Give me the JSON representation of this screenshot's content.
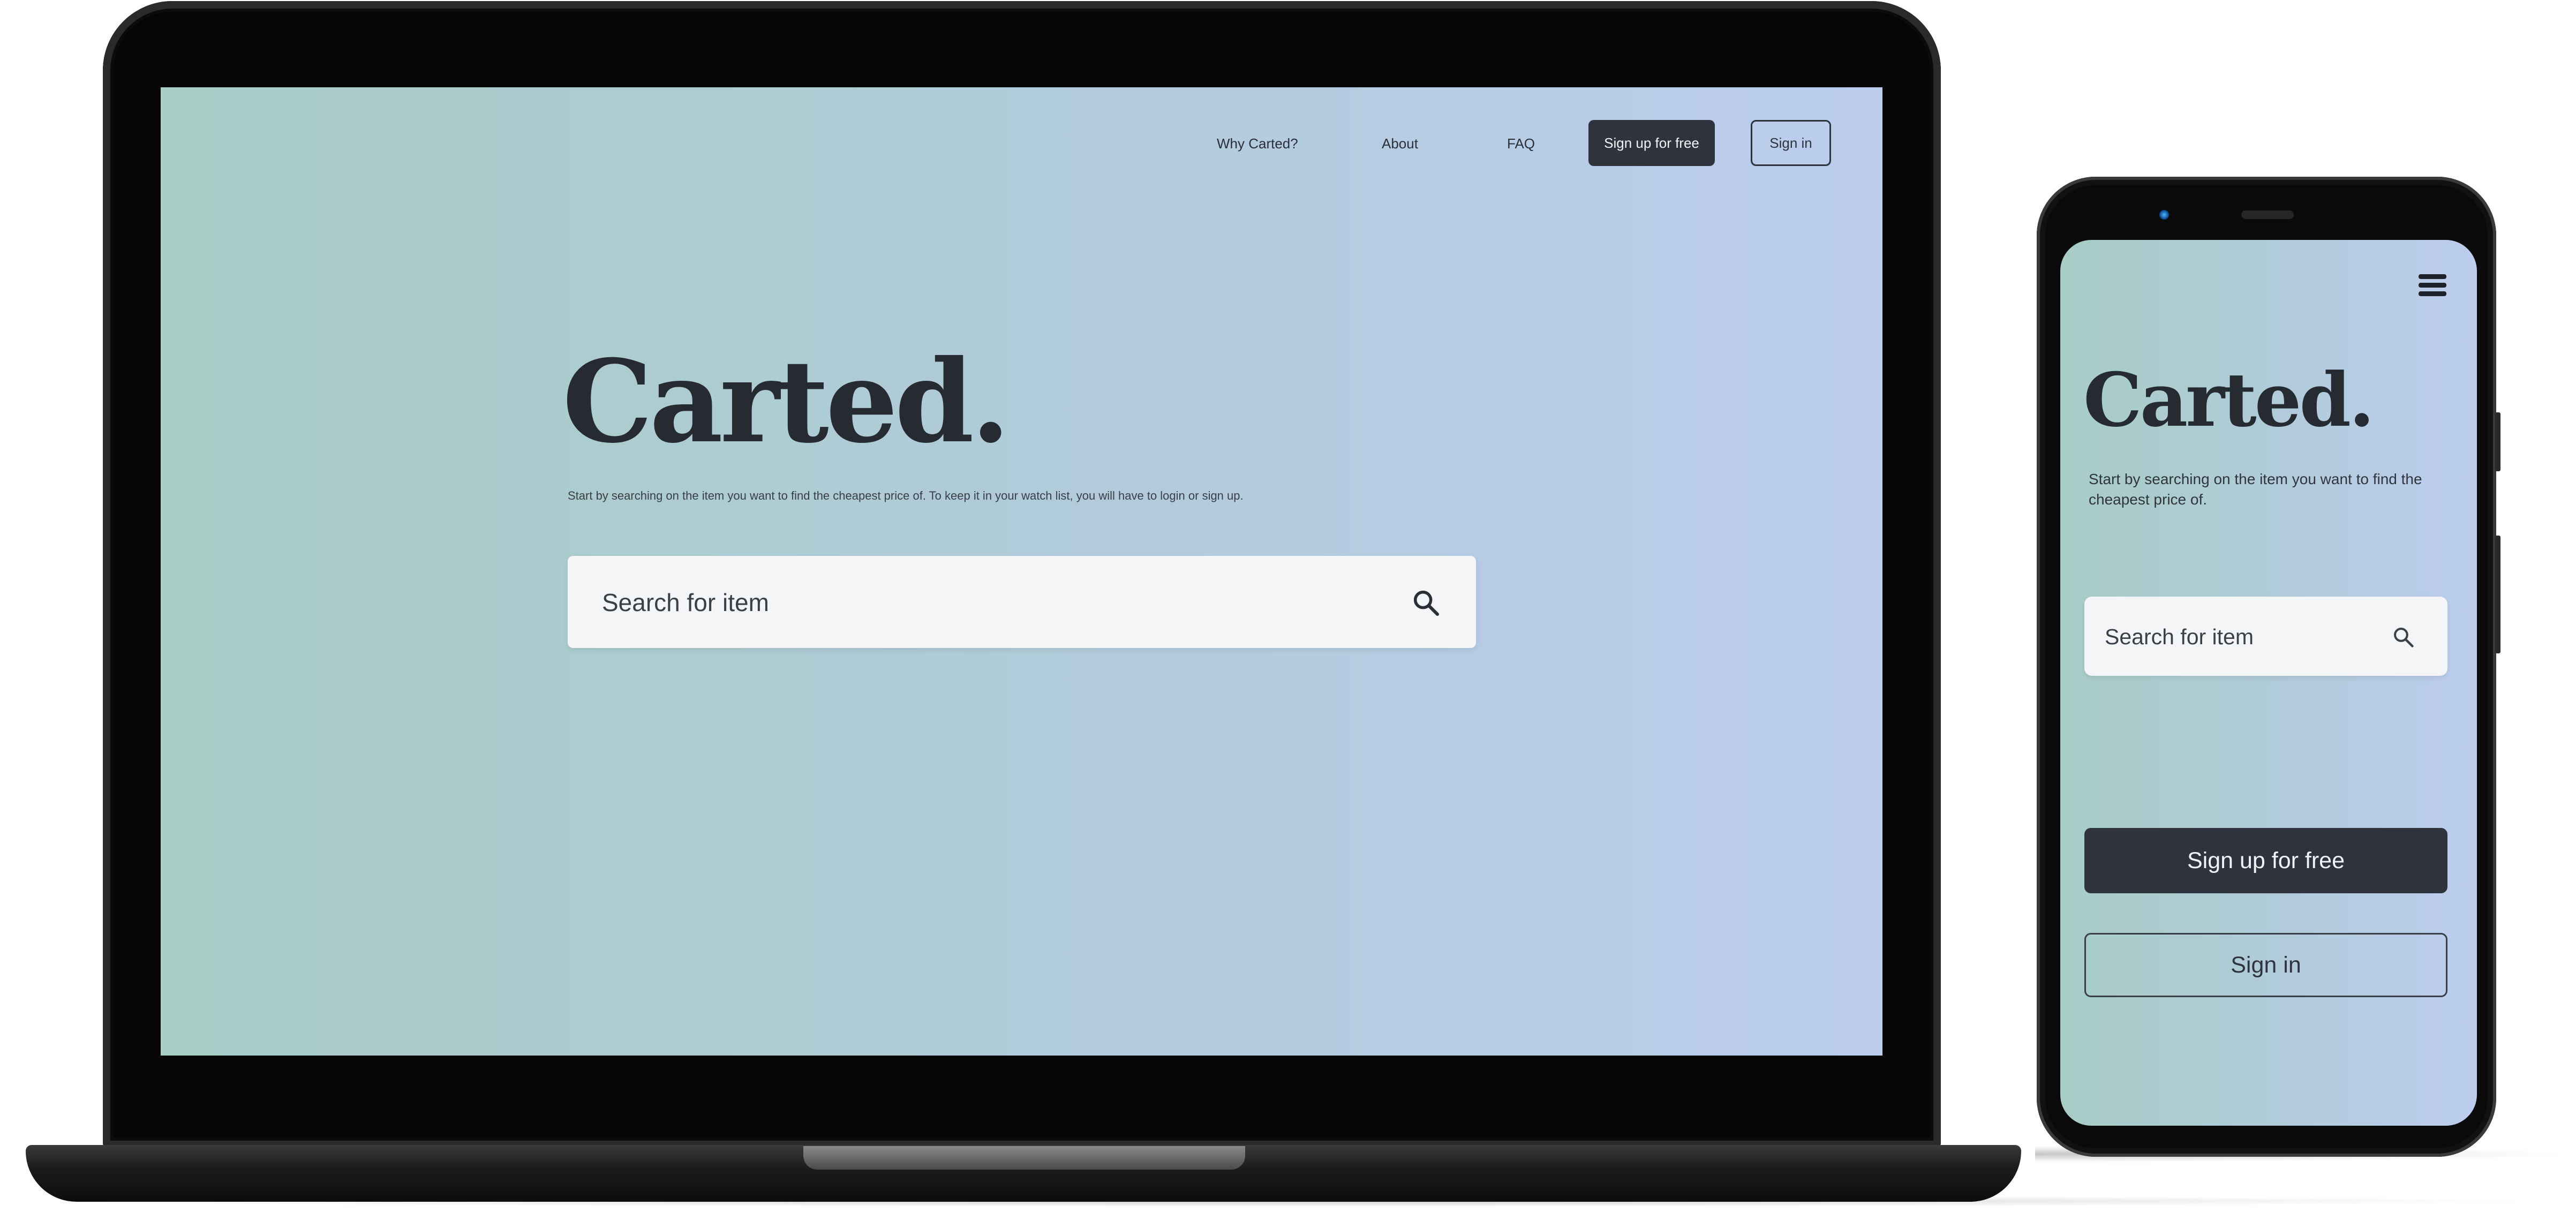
{
  "laptop": {
    "nav": {
      "links": [
        "Why Carted?",
        "About",
        "FAQ"
      ],
      "signup_label": "Sign up for free",
      "signin_label": "Sign in"
    },
    "brand": "Carted.",
    "subtitle": "Start by searching on the item you want to find the cheapest price of. To keep it in your watch list, you will have to login or sign up.",
    "search": {
      "placeholder": "Search for item",
      "icon": "search-icon"
    }
  },
  "phone": {
    "menu_icon": "hamburger-menu-icon",
    "brand": "Carted.",
    "subtitle": "Start by searching on the item you want to find the cheapest price of.",
    "search": {
      "placeholder": "Search for item",
      "icon": "search-icon"
    },
    "signup_label": "Sign up for free",
    "signin_label": "Sign in"
  },
  "colors": {
    "gradient_start": "#a7cdc6",
    "gradient_end": "#bccdee",
    "dark_button": "#2f333d",
    "brand_text": "#262a31"
  }
}
